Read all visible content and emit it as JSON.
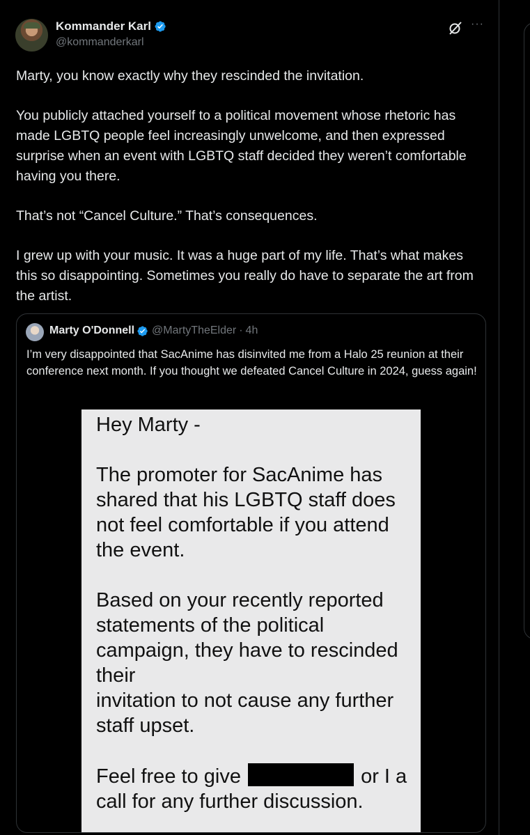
{
  "author": {
    "display_name": "Kommander Karl",
    "handle": "@kommanderkarl",
    "verified_icon": "verified-badge-icon",
    "more_label": "···"
  },
  "tweet": {
    "paragraphs": [
      "Marty, you know exactly why they rescinded the invitation.",
      "You publicly attached yourself to a political movement whose rhetoric has made LGBTQ people feel increasingly unwelcome, and then expressed surprise when an event with LGBTQ staff decided they weren’t comfortable having you there.",
      "That’s not “Cancel Culture.” That’s consequences.",
      "I grew up with your music. It was a huge part of my life. That’s what makes this so disappointing. Sometimes you really do have to separate the art from the artist."
    ]
  },
  "quote": {
    "display_name": "Marty O'Donnell",
    "handle": "@MartyTheElder",
    "separator": "·",
    "time": "4h",
    "text": "I’m very disappointed that SacAnime has disinvited me from a Halo 25 reunion at their conference next month. If you thought we defeated Cancel Culture in 2024, guess again!",
    "letter": {
      "greeting": "Hey Marty -",
      "p1": "The promoter for SacAnime has shared that his LGBTQ staff does not feel comfortable if you attend the event.",
      "p2_line1": "Based on your recently reported statements of the political campaign, they have to rescinded their",
      "p2_line2": "invitation to not cause any further staff upset.",
      "p3_before": "Feel free to give",
      "p3_after": "or I a",
      "p3_end": "call for any further discussion."
    }
  },
  "colors": {
    "background": "#000000",
    "text": "#e7e9ea",
    "muted": "#71767b",
    "border": "#2f3336",
    "verified": "#1d9bf0",
    "letter_bg": "#e9e9ea"
  }
}
